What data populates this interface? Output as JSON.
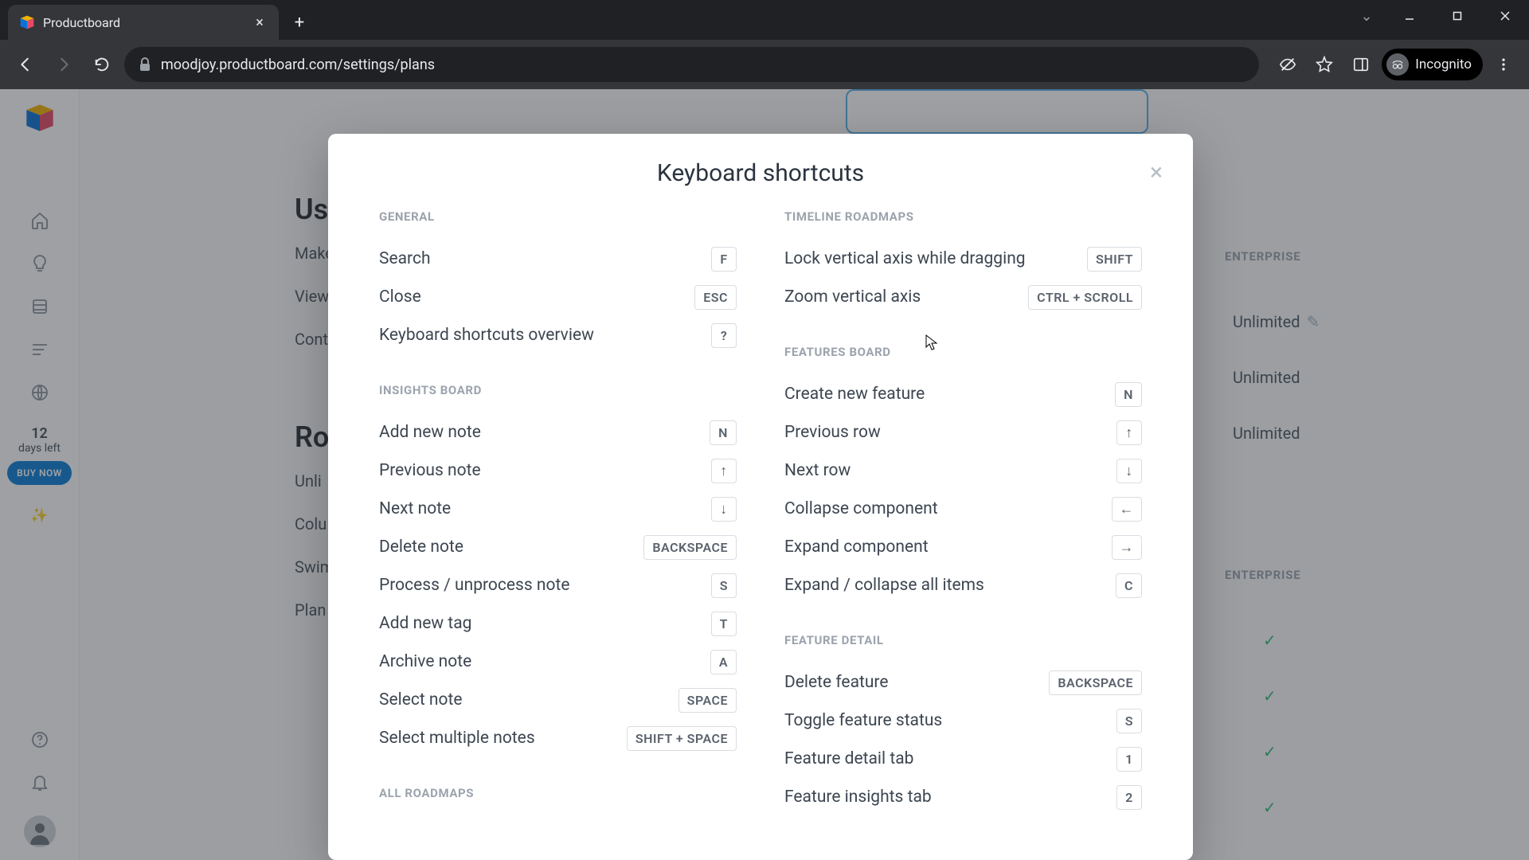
{
  "browser": {
    "tab_title": "Productboard",
    "url": "moodjoy.productboard.com/settings/plans",
    "incognito_label": "Incognito"
  },
  "rail": {
    "trial_days": "12",
    "trial_label": "days left",
    "buy_label": "BUY NOW"
  },
  "background": {
    "heading1": "Us",
    "row1": "Make",
    "row2": "View",
    "row3": "Cont",
    "heading2": "Ro",
    "row4": "Unli",
    "row5": "Colu",
    "row6": "Swim",
    "row7": "Plan",
    "plan_label1": "ENTERPRISE",
    "plan_label2": "ENTERPRISE",
    "unlimited": "Unlimited"
  },
  "modal": {
    "title": "Keyboard shortcuts",
    "left_sections": [
      {
        "title": "GENERAL",
        "rows": [
          {
            "label": "Search",
            "key": "F"
          },
          {
            "label": "Close",
            "key": "ESC"
          },
          {
            "label": "Keyboard shortcuts overview",
            "key": "?"
          }
        ]
      },
      {
        "title": "INSIGHTS BOARD",
        "rows": [
          {
            "label": "Add new note",
            "key": "N"
          },
          {
            "label": "Previous note",
            "key": "↑"
          },
          {
            "label": "Next note",
            "key": "↓"
          },
          {
            "label": "Delete note",
            "key": "BACKSPACE"
          },
          {
            "label": "Process / unprocess note",
            "key": "S"
          },
          {
            "label": "Add new tag",
            "key": "T"
          },
          {
            "label": "Archive note",
            "key": "A"
          },
          {
            "label": "Select note",
            "key": "SPACE"
          },
          {
            "label": "Select multiple notes",
            "key": "SHIFT + SPACE"
          }
        ]
      },
      {
        "title": "ALL ROADMAPS",
        "rows": []
      }
    ],
    "right_sections": [
      {
        "title": "TIMELINE ROADMAPS",
        "rows": [
          {
            "label": "Lock vertical axis while dragging",
            "key": "SHIFT"
          },
          {
            "label": "Zoom vertical axis",
            "key": "CTRL + SCROLL"
          }
        ]
      },
      {
        "title": "FEATURES BOARD",
        "rows": [
          {
            "label": "Create new feature",
            "key": "N"
          },
          {
            "label": "Previous row",
            "key": "↑"
          },
          {
            "label": "Next row",
            "key": "↓"
          },
          {
            "label": "Collapse component",
            "key": "←"
          },
          {
            "label": "Expand component",
            "key": "→"
          },
          {
            "label": "Expand / collapse all items",
            "key": "C"
          }
        ]
      },
      {
        "title": "FEATURE DETAIL",
        "rows": [
          {
            "label": "Delete feature",
            "key": "BACKSPACE"
          },
          {
            "label": "Toggle feature status",
            "key": "S"
          },
          {
            "label": "Feature detail tab",
            "key": "1"
          },
          {
            "label": "Feature insights tab",
            "key": "2"
          }
        ]
      }
    ]
  }
}
